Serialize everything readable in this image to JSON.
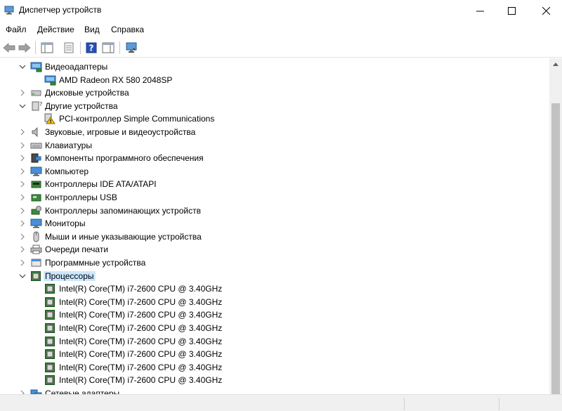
{
  "window": {
    "title": "Диспетчер устройств"
  },
  "menu": [
    "Файл",
    "Действие",
    "Вид",
    "Справка"
  ],
  "tree": [
    {
      "label": "Видеоадаптеры",
      "level": 0,
      "state": "open",
      "icon": "display-adapter-icon"
    },
    {
      "label": "AMD Radeon RX 580 2048SP",
      "level": 1,
      "state": "leaf",
      "icon": "display-adapter-icon"
    },
    {
      "label": "Дисковые устройства",
      "level": 0,
      "state": "closed",
      "icon": "disk-drive-icon"
    },
    {
      "label": "Другие устройства",
      "level": 0,
      "state": "open",
      "icon": "other-devices-icon"
    },
    {
      "label": "PCI-контроллер Simple Communications",
      "level": 1,
      "state": "leaf",
      "icon": "warning-icon"
    },
    {
      "label": "Звуковые, игровые и видеоустройства",
      "level": 0,
      "state": "closed",
      "icon": "speaker-icon"
    },
    {
      "label": "Клавиатуры",
      "level": 0,
      "state": "closed",
      "icon": "keyboard-icon"
    },
    {
      "label": "Компоненты программного обеспечения",
      "level": 0,
      "state": "closed",
      "icon": "software-component-icon"
    },
    {
      "label": "Компьютер",
      "level": 0,
      "state": "closed",
      "icon": "computer-icon"
    },
    {
      "label": "Контроллеры IDE ATA/ATAPI",
      "level": 0,
      "state": "closed",
      "icon": "ide-controller-icon"
    },
    {
      "label": "Контроллеры USB",
      "level": 0,
      "state": "closed",
      "icon": "usb-icon"
    },
    {
      "label": "Контроллеры запоминающих устройств",
      "level": 0,
      "state": "closed",
      "icon": "storage-controller-icon"
    },
    {
      "label": "Мониторы",
      "level": 0,
      "state": "closed",
      "icon": "monitor-icon"
    },
    {
      "label": "Мыши и иные указывающие устройства",
      "level": 0,
      "state": "closed",
      "icon": "mouse-icon"
    },
    {
      "label": "Очереди печати",
      "level": 0,
      "state": "closed",
      "icon": "printer-icon"
    },
    {
      "label": "Программные устройства",
      "level": 0,
      "state": "closed",
      "icon": "software-device-icon"
    },
    {
      "label": "Процессоры",
      "level": 0,
      "state": "open",
      "icon": "processor-icon",
      "selected": true
    },
    {
      "label": "Intel(R) Core(TM) i7-2600 CPU @ 3.40GHz",
      "level": 1,
      "state": "leaf",
      "icon": "processor-icon"
    },
    {
      "label": "Intel(R) Core(TM) i7-2600 CPU @ 3.40GHz",
      "level": 1,
      "state": "leaf",
      "icon": "processor-icon"
    },
    {
      "label": "Intel(R) Core(TM) i7-2600 CPU @ 3.40GHz",
      "level": 1,
      "state": "leaf",
      "icon": "processor-icon"
    },
    {
      "label": "Intel(R) Core(TM) i7-2600 CPU @ 3.40GHz",
      "level": 1,
      "state": "leaf",
      "icon": "processor-icon"
    },
    {
      "label": "Intel(R) Core(TM) i7-2600 CPU @ 3.40GHz",
      "level": 1,
      "state": "leaf",
      "icon": "processor-icon"
    },
    {
      "label": "Intel(R) Core(TM) i7-2600 CPU @ 3.40GHz",
      "level": 1,
      "state": "leaf",
      "icon": "processor-icon"
    },
    {
      "label": "Intel(R) Core(TM) i7-2600 CPU @ 3.40GHz",
      "level": 1,
      "state": "leaf",
      "icon": "processor-icon"
    },
    {
      "label": "Intel(R) Core(TM) i7-2600 CPU @ 3.40GHz",
      "level": 1,
      "state": "leaf",
      "icon": "processor-icon"
    },
    {
      "label": "Сетевые адаптеры",
      "level": 0,
      "state": "closed",
      "icon": "network-adapter-icon"
    }
  ],
  "colors": {
    "selection": "#cce8ff",
    "accent": "#2b6cc4"
  }
}
